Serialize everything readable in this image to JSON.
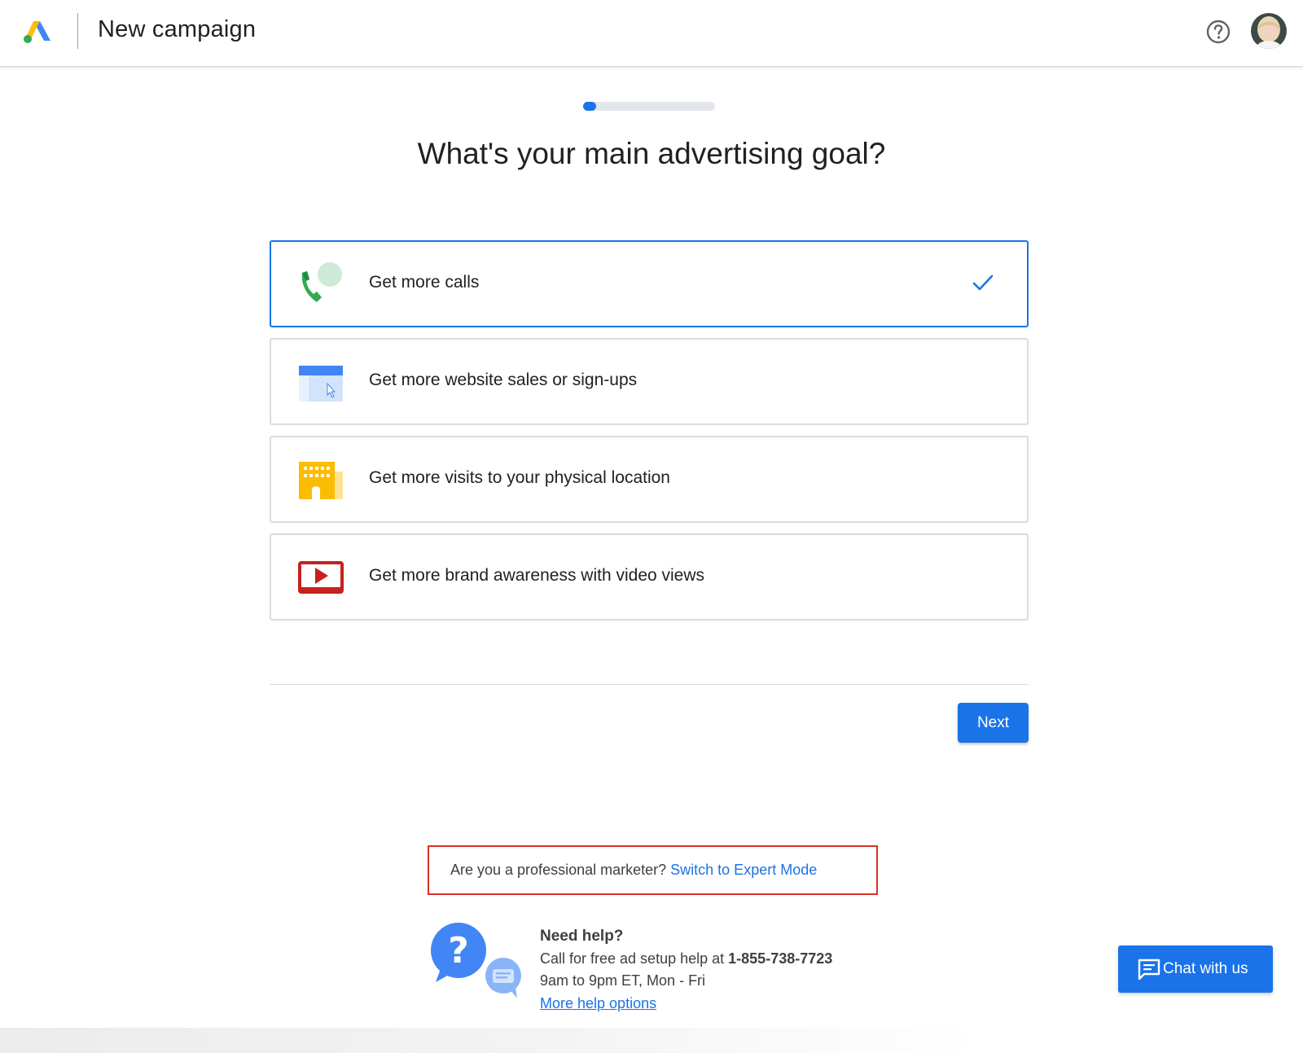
{
  "header": {
    "title": "New campaign",
    "logo_icon": "google-ads-logo",
    "help_icon": "help-circle-icon",
    "avatar_icon": "user-avatar"
  },
  "progress": {
    "fraction": 0.1
  },
  "page": {
    "title": "What's your main advertising goal?"
  },
  "options": [
    {
      "label": "Get more calls",
      "icon": "phone-chat-icon",
      "selected": true
    },
    {
      "label": "Get more website sales or sign-ups",
      "icon": "browser-cursor-icon",
      "selected": false
    },
    {
      "label": "Get more visits to your physical location",
      "icon": "storefront-icon",
      "selected": false
    },
    {
      "label": "Get more brand awareness with video views",
      "icon": "video-play-icon",
      "selected": false
    }
  ],
  "actions": {
    "next_label": "Next"
  },
  "expert_mode": {
    "prompt": "Are you a professional marketer?",
    "link_label": "Switch to Expert Mode"
  },
  "help": {
    "heading": "Need help?",
    "call_text": "Call for free ad setup help at",
    "phone": "1-855-738-7723",
    "hours": "9am to 9pm ET, Mon - Fri",
    "more_link": "More help options"
  },
  "chat": {
    "label": "Chat with us"
  },
  "colors": {
    "accent": "#1a73e8",
    "highlight_box": "#d93025",
    "border": "#dadce0"
  }
}
